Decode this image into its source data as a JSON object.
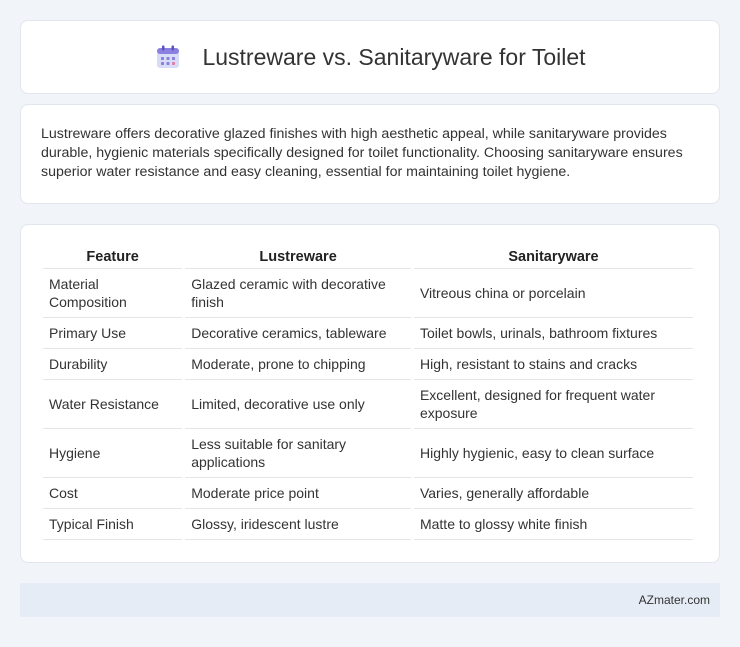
{
  "header": {
    "icon": "calendar-grid-icon",
    "title": "Lustreware vs. Sanitaryware for Toilet"
  },
  "intro": {
    "text": "Lustreware offers decorative glazed finishes with high aesthetic appeal, while sanitaryware provides durable, hygienic materials specifically designed for toilet functionality. Choosing sanitaryware ensures superior water resistance and easy cleaning, essential for maintaining toilet hygiene."
  },
  "table": {
    "headers": [
      "Feature",
      "Lustreware",
      "Sanitaryware"
    ],
    "rows": [
      [
        "Material Composition",
        "Glazed ceramic with decorative finish",
        "Vitreous china or porcelain"
      ],
      [
        "Primary Use",
        "Decorative ceramics, tableware",
        "Toilet bowls, urinals, bathroom fixtures"
      ],
      [
        "Durability",
        "Moderate, prone to chipping",
        "High, resistant to stains and cracks"
      ],
      [
        "Water Resistance",
        "Limited, decorative use only",
        "Excellent, designed for frequent water exposure"
      ],
      [
        "Hygiene",
        "Less suitable for sanitary applications",
        "Highly hygienic, easy to clean surface"
      ],
      [
        "Cost",
        "Moderate price point",
        "Varies, generally affordable"
      ],
      [
        "Typical Finish",
        "Glossy, iridescent lustre",
        "Matte to glossy white finish"
      ]
    ]
  },
  "footer": {
    "brand": "AZmater.com"
  },
  "colors": {
    "background": "#f1f4f9",
    "card": "#ffffff",
    "footer": "#e6ecf5",
    "icon_accent": "#7b6fd6"
  }
}
